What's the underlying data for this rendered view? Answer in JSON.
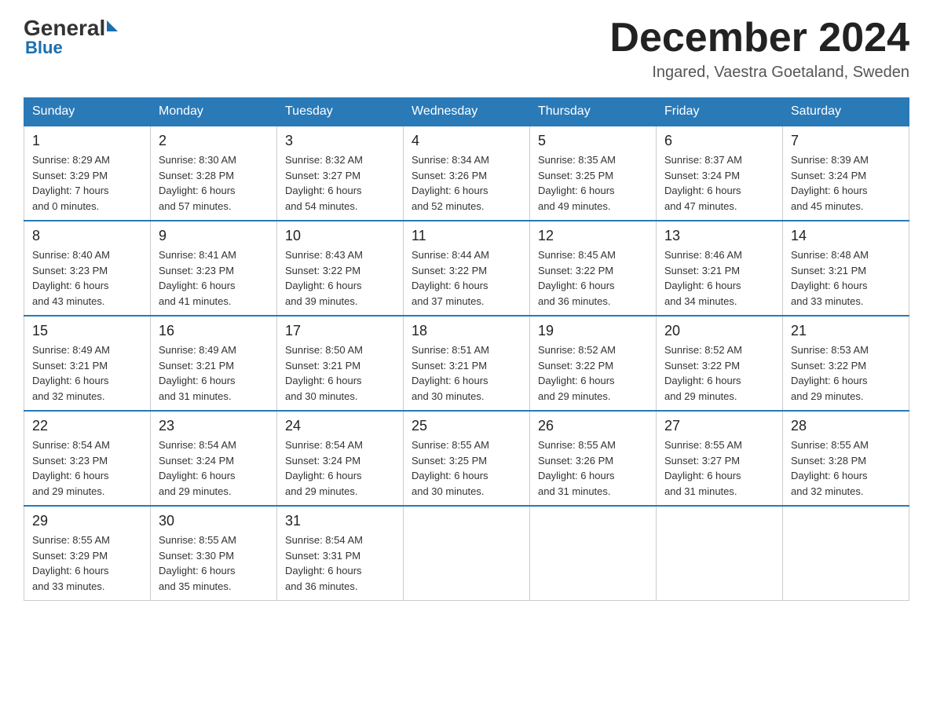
{
  "header": {
    "logo_general": "General",
    "logo_blue": "Blue",
    "month_title": "December 2024",
    "location": "Ingared, Vaestra Goetaland, Sweden"
  },
  "days_of_week": [
    "Sunday",
    "Monday",
    "Tuesday",
    "Wednesday",
    "Thursday",
    "Friday",
    "Saturday"
  ],
  "weeks": [
    [
      {
        "day": "1",
        "sunrise": "8:29 AM",
        "sunset": "3:29 PM",
        "daylight": "7 hours and 0 minutes."
      },
      {
        "day": "2",
        "sunrise": "8:30 AM",
        "sunset": "3:28 PM",
        "daylight": "6 hours and 57 minutes."
      },
      {
        "day": "3",
        "sunrise": "8:32 AM",
        "sunset": "3:27 PM",
        "daylight": "6 hours and 54 minutes."
      },
      {
        "day": "4",
        "sunrise": "8:34 AM",
        "sunset": "3:26 PM",
        "daylight": "6 hours and 52 minutes."
      },
      {
        "day": "5",
        "sunrise": "8:35 AM",
        "sunset": "3:25 PM",
        "daylight": "6 hours and 49 minutes."
      },
      {
        "day": "6",
        "sunrise": "8:37 AM",
        "sunset": "3:24 PM",
        "daylight": "6 hours and 47 minutes."
      },
      {
        "day": "7",
        "sunrise": "8:39 AM",
        "sunset": "3:24 PM",
        "daylight": "6 hours and 45 minutes."
      }
    ],
    [
      {
        "day": "8",
        "sunrise": "8:40 AM",
        "sunset": "3:23 PM",
        "daylight": "6 hours and 43 minutes."
      },
      {
        "day": "9",
        "sunrise": "8:41 AM",
        "sunset": "3:23 PM",
        "daylight": "6 hours and 41 minutes."
      },
      {
        "day": "10",
        "sunrise": "8:43 AM",
        "sunset": "3:22 PM",
        "daylight": "6 hours and 39 minutes."
      },
      {
        "day": "11",
        "sunrise": "8:44 AM",
        "sunset": "3:22 PM",
        "daylight": "6 hours and 37 minutes."
      },
      {
        "day": "12",
        "sunrise": "8:45 AM",
        "sunset": "3:22 PM",
        "daylight": "6 hours and 36 minutes."
      },
      {
        "day": "13",
        "sunrise": "8:46 AM",
        "sunset": "3:21 PM",
        "daylight": "6 hours and 34 minutes."
      },
      {
        "day": "14",
        "sunrise": "8:48 AM",
        "sunset": "3:21 PM",
        "daylight": "6 hours and 33 minutes."
      }
    ],
    [
      {
        "day": "15",
        "sunrise": "8:49 AM",
        "sunset": "3:21 PM",
        "daylight": "6 hours and 32 minutes."
      },
      {
        "day": "16",
        "sunrise": "8:49 AM",
        "sunset": "3:21 PM",
        "daylight": "6 hours and 31 minutes."
      },
      {
        "day": "17",
        "sunrise": "8:50 AM",
        "sunset": "3:21 PM",
        "daylight": "6 hours and 30 minutes."
      },
      {
        "day": "18",
        "sunrise": "8:51 AM",
        "sunset": "3:21 PM",
        "daylight": "6 hours and 30 minutes."
      },
      {
        "day": "19",
        "sunrise": "8:52 AM",
        "sunset": "3:22 PM",
        "daylight": "6 hours and 29 minutes."
      },
      {
        "day": "20",
        "sunrise": "8:52 AM",
        "sunset": "3:22 PM",
        "daylight": "6 hours and 29 minutes."
      },
      {
        "day": "21",
        "sunrise": "8:53 AM",
        "sunset": "3:22 PM",
        "daylight": "6 hours and 29 minutes."
      }
    ],
    [
      {
        "day": "22",
        "sunrise": "8:54 AM",
        "sunset": "3:23 PM",
        "daylight": "6 hours and 29 minutes."
      },
      {
        "day": "23",
        "sunrise": "8:54 AM",
        "sunset": "3:24 PM",
        "daylight": "6 hours and 29 minutes."
      },
      {
        "day": "24",
        "sunrise": "8:54 AM",
        "sunset": "3:24 PM",
        "daylight": "6 hours and 29 minutes."
      },
      {
        "day": "25",
        "sunrise": "8:55 AM",
        "sunset": "3:25 PM",
        "daylight": "6 hours and 30 minutes."
      },
      {
        "day": "26",
        "sunrise": "8:55 AM",
        "sunset": "3:26 PM",
        "daylight": "6 hours and 31 minutes."
      },
      {
        "day": "27",
        "sunrise": "8:55 AM",
        "sunset": "3:27 PM",
        "daylight": "6 hours and 31 minutes."
      },
      {
        "day": "28",
        "sunrise": "8:55 AM",
        "sunset": "3:28 PM",
        "daylight": "6 hours and 32 minutes."
      }
    ],
    [
      {
        "day": "29",
        "sunrise": "8:55 AM",
        "sunset": "3:29 PM",
        "daylight": "6 hours and 33 minutes."
      },
      {
        "day": "30",
        "sunrise": "8:55 AM",
        "sunset": "3:30 PM",
        "daylight": "6 hours and 35 minutes."
      },
      {
        "day": "31",
        "sunrise": "8:54 AM",
        "sunset": "3:31 PM",
        "daylight": "6 hours and 36 minutes."
      },
      null,
      null,
      null,
      null
    ]
  ]
}
